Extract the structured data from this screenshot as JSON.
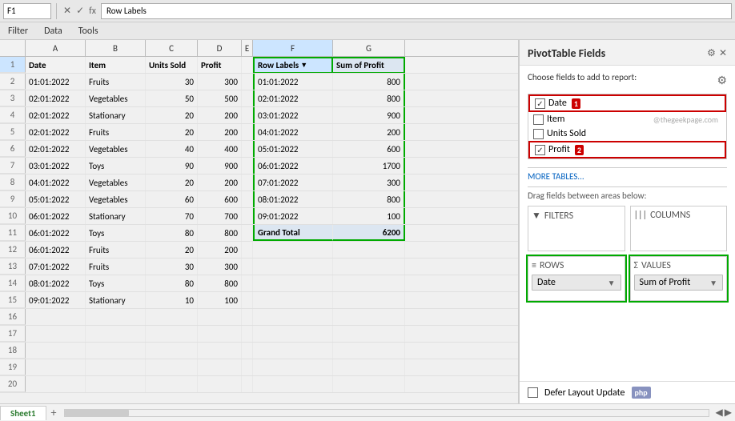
{
  "topbar": {
    "cell_ref": "F1",
    "formula_text": "Row Labels",
    "icon_x": "✕",
    "icon_check": "✓",
    "icon_fx": "fx"
  },
  "menubar": {
    "items": [
      "Filter",
      "Data",
      "Tools"
    ]
  },
  "spreadsheet": {
    "col_headers": [
      "",
      "A",
      "B",
      "C",
      "D",
      "E",
      "F",
      "G"
    ],
    "header_row": {
      "row_num": "1",
      "cells": [
        "Date",
        "Item",
        "Units Sold",
        "Profit",
        "",
        "Row Labels",
        "Sum of Profit"
      ]
    },
    "rows": [
      {
        "row_num": "2",
        "cells": [
          "01:01:2022",
          "Fruits",
          "30",
          "300",
          "",
          "01:01:2022",
          "800"
        ]
      },
      {
        "row_num": "3",
        "cells": [
          "02:01:2022",
          "Vegetables",
          "50",
          "500",
          "",
          "02:01:2022",
          "800"
        ]
      },
      {
        "row_num": "4",
        "cells": [
          "02:01:2022",
          "Stationary",
          "20",
          "200",
          "",
          "03:01:2022",
          "900"
        ]
      },
      {
        "row_num": "5",
        "cells": [
          "02:01:2022",
          "Fruits",
          "20",
          "200",
          "",
          "04:01:2022",
          "200"
        ]
      },
      {
        "row_num": "6",
        "cells": [
          "02:01:2022",
          "Vegetables",
          "40",
          "400",
          "",
          "05:01:2022",
          "600"
        ]
      },
      {
        "row_num": "7",
        "cells": [
          "03:01:2022",
          "Toys",
          "90",
          "900",
          "",
          "06:01:2022",
          "1700"
        ]
      },
      {
        "row_num": "8",
        "cells": [
          "04:01:2022",
          "Vegetables",
          "20",
          "200",
          "",
          "07:01:2022",
          "300"
        ]
      },
      {
        "row_num": "9",
        "cells": [
          "05:01:2022",
          "Vegetables",
          "60",
          "600",
          "",
          "08:01:2022",
          "800"
        ]
      },
      {
        "row_num": "10",
        "cells": [
          "06:01:2022",
          "Stationary",
          "70",
          "700",
          "",
          "09:01:2022",
          "100"
        ]
      },
      {
        "row_num": "11",
        "cells": [
          "06:01:2022",
          "Toys",
          "80",
          "800",
          "",
          "Grand Total",
          "6200"
        ]
      },
      {
        "row_num": "12",
        "cells": [
          "06:01:2022",
          "Fruits",
          "20",
          "200",
          "",
          "",
          ""
        ]
      },
      {
        "row_num": "13",
        "cells": [
          "07:01:2022",
          "Fruits",
          "30",
          "300",
          "",
          "",
          ""
        ]
      },
      {
        "row_num": "14",
        "cells": [
          "08:01:2022",
          "Toys",
          "80",
          "800",
          "",
          "",
          ""
        ]
      },
      {
        "row_num": "15",
        "cells": [
          "09:01:2022",
          "Stationary",
          "10",
          "100",
          "",
          "",
          ""
        ]
      },
      {
        "row_num": "16",
        "cells": [
          "",
          "",
          "",
          "",
          "",
          "",
          ""
        ]
      },
      {
        "row_num": "17",
        "cells": [
          "",
          "",
          "",
          "",
          "",
          "",
          ""
        ]
      },
      {
        "row_num": "18",
        "cells": [
          "",
          "",
          "",
          "",
          "",
          "",
          ""
        ]
      },
      {
        "row_num": "19",
        "cells": [
          "",
          "",
          "",
          "",
          "",
          "",
          ""
        ]
      },
      {
        "row_num": "20",
        "cells": [
          "",
          "",
          "",
          "",
          "",
          "",
          ""
        ]
      }
    ]
  },
  "pivot_panel": {
    "title": "PivotTable Fields",
    "subtitle": "Choose fields to add to report:",
    "fields": [
      {
        "name": "Date",
        "checked": true,
        "highlighted": true,
        "badge": "1"
      },
      {
        "name": "Item",
        "checked": false,
        "highlighted": false,
        "badge": ""
      },
      {
        "name": "Units Sold",
        "checked": false,
        "highlighted": false,
        "badge": ""
      },
      {
        "name": "Profit",
        "checked": true,
        "highlighted": true,
        "badge": "2"
      }
    ],
    "more_tables": "MORE TABLES...",
    "drag_text": "Drag fields between areas below:",
    "areas": {
      "filters_label": "FILTERS",
      "columns_label": "COLUMNS",
      "rows_label": "ROWS",
      "values_label": "VALUES",
      "rows_chip": "Date",
      "values_chip": "Sum of Profit"
    },
    "footer_defer": "Defer Layout Update",
    "watermark": "@thegeekpage.com"
  },
  "sheet_tabs": {
    "tabs": [
      "Sheet1"
    ],
    "add_label": "+"
  }
}
